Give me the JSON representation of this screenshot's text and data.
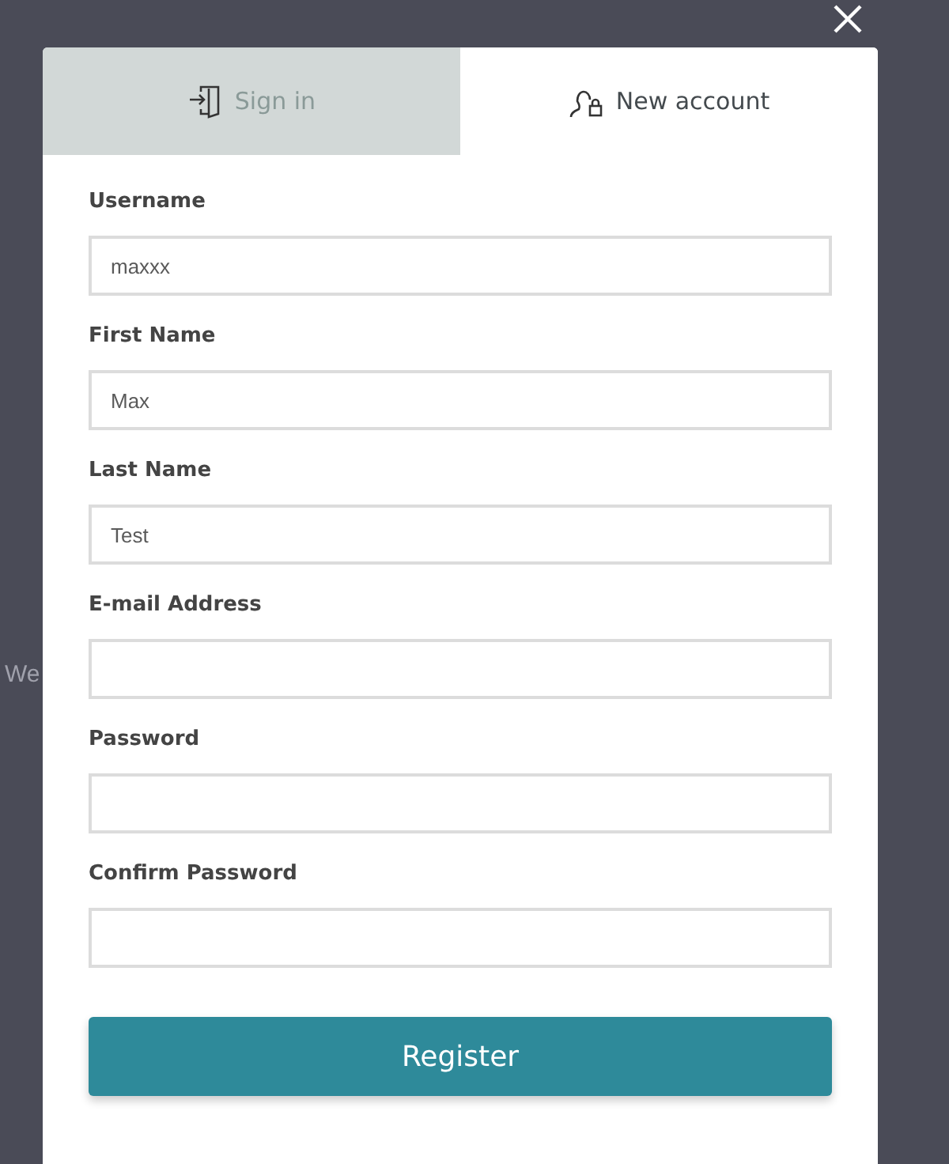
{
  "background_text": "We",
  "tabs": [
    {
      "label": "Sign in",
      "kind": "signin",
      "selected": false
    },
    {
      "label": "New account",
      "kind": "account",
      "selected": true
    }
  ],
  "fields": [
    {
      "label": "Username",
      "value": "maxxx"
    },
    {
      "label": "First Name",
      "value": "Max"
    },
    {
      "label": "Last Name",
      "value": "Test"
    },
    {
      "label": "E-mail Address"
    },
    {
      "label": "Password"
    },
    {
      "label": "Confirm Password"
    }
  ],
  "submit": {
    "label": "Register"
  }
}
